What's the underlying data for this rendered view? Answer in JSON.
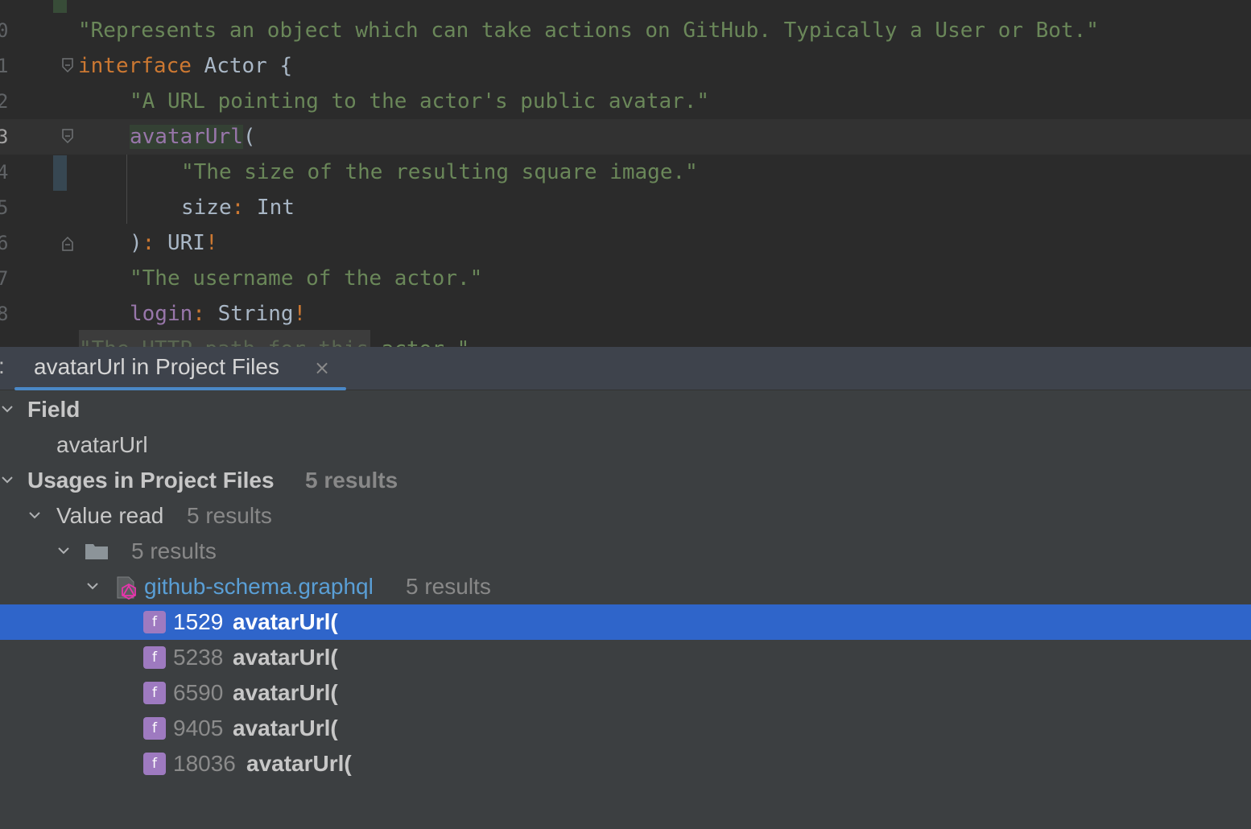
{
  "editor": {
    "lines": [
      {
        "num": "0"
      },
      {
        "num": "1",
        "keyword": "interface",
        "name": " Actor {"
      },
      {
        "num": "2"
      },
      {
        "num": "3",
        "field": "avatarUrl",
        "paren": "("
      },
      {
        "num": "4"
      },
      {
        "num": "5",
        "field": "size",
        "colon": ":",
        "type": " Int"
      },
      {
        "num": "6",
        "close": ")",
        "colon": ":",
        "type": " URI",
        "bang": "!"
      },
      {
        "num": "7"
      },
      {
        "num": "8",
        "field": "login",
        "colon": ":",
        "type": " String",
        "bang": "!"
      }
    ],
    "strings": {
      "actor_desc": "\"Represents an object which can take actions on GitHub. Typically a User or Bot.\"",
      "avatar_desc": "\"A URL pointing to the actor's public avatar.\"",
      "size_desc": "\"The size of the resulting square image.\"",
      "login_desc": "\"The username of the actor.\"",
      "resource_desc": "\"The HTTP path for this actor.\""
    }
  },
  "find_window": {
    "prefix": ":",
    "tab_label": "avatarUrl in Project Files",
    "tab_close": "×",
    "tree": {
      "field_header": "Field",
      "field_name": "avatarUrl",
      "usages_header": "Usages in Project Files",
      "usages_count": "5 results",
      "value_read": "Value read",
      "value_read_count": "5 results",
      "folder_count": "5 results",
      "file_name": "github-schema.graphql",
      "file_count": "5 results",
      "results": [
        {
          "icon": "f",
          "line": "1529",
          "text": "avatarUrl("
        },
        {
          "icon": "f",
          "line": "5238",
          "text": "avatarUrl("
        },
        {
          "icon": "f",
          "line": "6590",
          "text": "avatarUrl("
        },
        {
          "icon": "f",
          "line": "9405",
          "text": "avatarUrl("
        },
        {
          "icon": "f",
          "line": "18036",
          "text": "avatarUrl("
        }
      ]
    }
  },
  "colors": {
    "editor_bg": "#2b2b2b",
    "panel_bg": "#3c3f41",
    "selection": "#2f65ca",
    "string": "#6a8759",
    "keyword": "#cc7832",
    "field": "#9876aa",
    "link": "#5a9fd6"
  }
}
